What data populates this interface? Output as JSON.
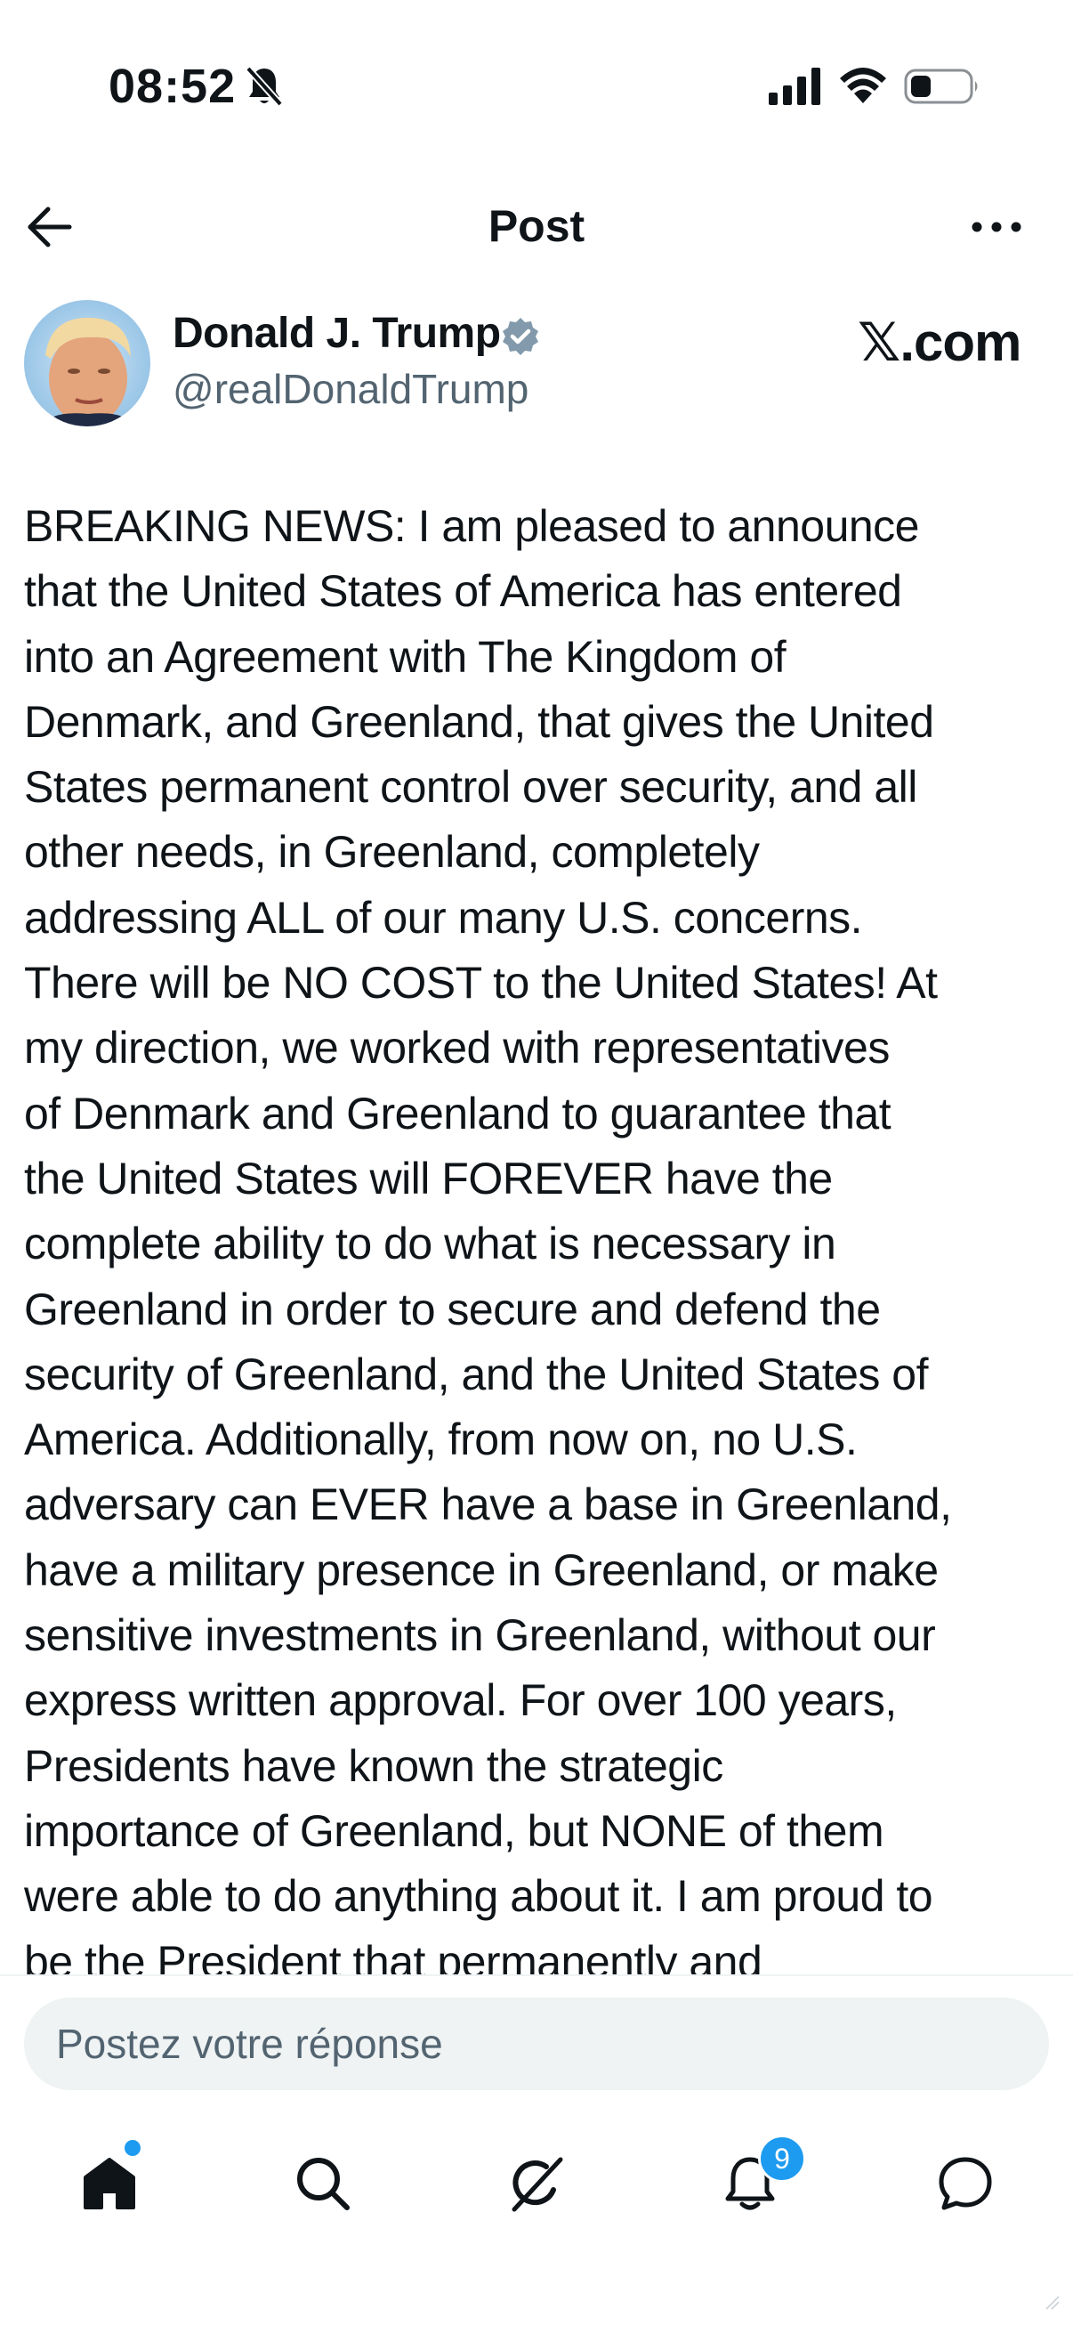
{
  "status_bar": {
    "time": "08:52",
    "icons": [
      "bell-off-icon",
      "signal-icon",
      "wifi-icon",
      "battery-icon"
    ],
    "battery_level": 0.25
  },
  "header": {
    "title": "Post",
    "back_icon": "arrow-left-icon",
    "more_icon": "ellipsis-icon"
  },
  "author": {
    "name": "Donald J. Trump",
    "handle": "@realDonaldTrump",
    "verified": true,
    "source_logo": "𝕏.com"
  },
  "post": {
    "text": "BREAKING NEWS: I am pleased to announce that the United States of America has entered into an Agreement with The Kingdom of Denmark, and Greenland, that gives the United States permanent control over security, and all other needs, in Greenland, completely addressing ALL of our many U.S. concerns. There will be NO COST to the United States! At my direction, we worked with representatives of Denmark and Greenland to guarantee that the United States will FOREVER have the complete ability to do what is necessary in Greenland in order to secure and defend the security of Greenland, and the United States of America. Additionally, from now on, no U.S. adversary can EVER have a base in Greenland, have a military presence in Greenland, or make sensitive investments in Greenland, without our express written approval. For over 100 years, Presidents have known the strategic importance of Greenland, but NONE of them were able to do anything about it. I am proud to be the President that permanently and",
    "lines": [
      "BREAKING NEWS: I am pleased to announce",
      "that the United States of America has entered",
      "into an Agreement with The Kingdom of",
      "Denmark, and Greenland, that gives the United",
      "States permanent control over security, and all",
      "other needs, in Greenland, completely",
      "addressing ALL of our many U.S. concerns.",
      "There will be NO COST to the United States! At",
      "my direction, we worked with representatives",
      "of Denmark and Greenland to guarantee that",
      "the United States will FOREVER have the",
      "complete ability to do what is necessary in",
      "Greenland in order to secure and defend the",
      "security of Greenland, and the United States of",
      "America. Additionally, from now on, no U.S.",
      "adversary can EVER have a base in Greenland,",
      "have a military presence in Greenland, or make",
      "sensitive investments in Greenland, without our",
      "express written approval. For over 100 years,",
      "Presidents have known the strategic",
      "importance of Greenland, but NONE of them",
      "were able to do anything about it. I am proud to",
      "be the President that permanently and"
    ]
  },
  "reply": {
    "placeholder": "Postez votre réponse"
  },
  "bottom_nav": {
    "items": [
      {
        "icon": "home-icon",
        "badge": "dot"
      },
      {
        "icon": "search-icon"
      },
      {
        "icon": "grok-icon"
      },
      {
        "icon": "bell-icon",
        "badge": "9"
      },
      {
        "icon": "messages-icon"
      }
    ]
  },
  "colors": {
    "text": "#0f1419",
    "secondary": "#536471",
    "accent": "#1d9bf0",
    "input_bg": "#eff3f4"
  }
}
